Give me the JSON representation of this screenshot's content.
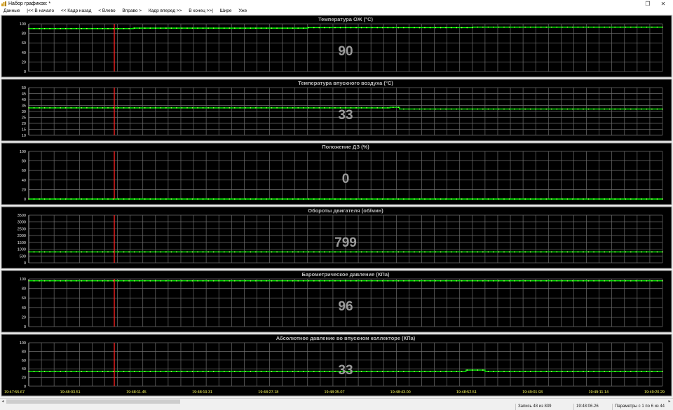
{
  "window": {
    "title": "Набор графиков: *",
    "accent": "#ffffff"
  },
  "menu": [
    "Данные",
    "|<< В начало",
    "<< Кадр назад",
    "< Влево",
    "Вправо >",
    "Кадр вперед >>",
    "В конец >>|",
    "Шире",
    "Уже"
  ],
  "status": {
    "record": "Запись 48 из 839",
    "time": "19:48:06.26",
    "params": "Параметры с 1 по 6 из 44"
  },
  "colors": {
    "plot_bg": "#000000",
    "grid": "#6e6e6e",
    "series": "#00ff00",
    "series_points": "#a8ff60",
    "cursor": "#ff2020",
    "title_text": "#bdbdbd",
    "value_text": "#9a9a9a",
    "tick_text": "#f0f0f0",
    "time_text": "#ffff60"
  },
  "chart_data": [
    {
      "type": "line",
      "title": "Температура ОЖ  (°С)",
      "current_value": "90",
      "ylim": [
        0,
        100
      ],
      "yticks": [
        "0",
        "20",
        "40",
        "60",
        "80",
        "100"
      ],
      "segments": [
        [
          0,
          0.165,
          90
        ],
        [
          0.165,
          0.44,
          91
        ],
        [
          0.44,
          0.7,
          92
        ],
        [
          0.7,
          1.0,
          93
        ]
      ]
    },
    {
      "type": "line",
      "title": "Температура впускного воздуха  (°С)",
      "current_value": "33",
      "ylim": [
        10,
        50
      ],
      "yticks": [
        "10",
        "15",
        "20",
        "25",
        "30",
        "35",
        "40",
        "45",
        "50"
      ],
      "segments": [
        [
          0,
          0.57,
          33
        ],
        [
          0.57,
          0.585,
          33.5
        ],
        [
          0.585,
          1.0,
          32
        ]
      ]
    },
    {
      "type": "line",
      "title": "Положение ДЗ  (%)",
      "current_value": "0",
      "ylim": [
        0,
        100
      ],
      "yticks": [
        "0",
        "20",
        "40",
        "60",
        "80",
        "100"
      ],
      "segments": [
        [
          0,
          1.0,
          0
        ]
      ]
    },
    {
      "type": "line",
      "title": "Обороты двигателя  (об/мин)",
      "current_value": "799",
      "ylim": [
        0,
        3500
      ],
      "yticks": [
        "0",
        "500",
        "1000",
        "1500",
        "2000",
        "2500",
        "3000",
        "3500"
      ],
      "segments": [
        [
          0,
          1.0,
          800
        ]
      ]
    },
    {
      "type": "line",
      "title": "Барометрическое давление  (КПа)",
      "current_value": "96",
      "ylim": [
        0,
        100
      ],
      "yticks": [
        "0",
        "20",
        "40",
        "60",
        "80",
        "100"
      ],
      "segments": [
        [
          0,
          1.0,
          96
        ]
      ]
    },
    {
      "type": "line",
      "title": "Абсолютное давление во впускном коллекторе  (КПа)",
      "current_value": "33",
      "ylim": [
        0,
        100
      ],
      "yticks": [
        "0",
        "20",
        "40",
        "60",
        "80",
        "100"
      ],
      "segments": [
        [
          0,
          0.69,
          34
        ],
        [
          0.69,
          0.72,
          37
        ],
        [
          0.72,
          1.0,
          34
        ]
      ]
    }
  ],
  "cursor_fraction": 0.135,
  "time_labels": [
    "19:47:55.67",
    "19:48:03.51",
    "19:48:11.45",
    "19:48:19.31",
    "19:48:27.18",
    "19:48:35.07",
    "19:48:43.00",
    "19:48:52.51",
    "19:49:01.93",
    "19:49:11.14",
    "19:49:20.29"
  ]
}
